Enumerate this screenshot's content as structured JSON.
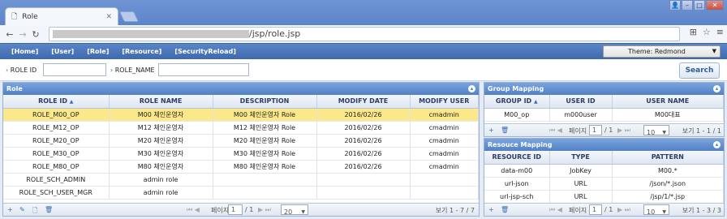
{
  "browser": {
    "tab_title": "Role",
    "url_path": "/jsp/role.jsp"
  },
  "menu": [
    "[Home]",
    "[User]",
    "[Role]",
    "[Resource]",
    "[SecurityReload]"
  ],
  "theme": "Theme: Redmond",
  "search": {
    "role_id_label": "ROLE ID",
    "role_name_label": "ROLE_NAME",
    "button": "Search"
  },
  "role": {
    "title": "Role",
    "columns": [
      "ROLE ID",
      "ROLE NAME",
      "DESCRIPTION",
      "MODIFY DATE",
      "MODIFY USER"
    ],
    "rows": [
      [
        "ROLE_M00_OP",
        "M00 체인운영자",
        "M00 체인운영자 Role",
        "2016/02/26",
        "cmadmin"
      ],
      [
        "ROLE_M12_OP",
        "M12 체인운영자",
        "M12 체인운영자 Role",
        "2016/02/26",
        "cmadmin"
      ],
      [
        "ROLE_M20_OP",
        "M20 체인운영자",
        "M20 체인운영자 Role",
        "2016/02/26",
        "cmadmin"
      ],
      [
        "ROLE_M30_OP",
        "M30 체인운영자",
        "M30 체인운영자 Role",
        "2016/02/26",
        "cmadmin"
      ],
      [
        "ROLE_M80_OP",
        "M80 체인운영자",
        "M80 체인운영자 Role",
        "2016/02/26",
        "cmadmin"
      ],
      [
        "ROLE_SCH_ADMIN",
        "admin role",
        "",
        "",
        ""
      ],
      [
        "ROLE_SCH_USER_MGR",
        "admin role",
        "",
        "",
        ""
      ]
    ],
    "pager": {
      "page_label": "페이지",
      "page": "1",
      "of": "/ 1",
      "size": "20",
      "view": "보기 1 - 7 / 7"
    }
  },
  "group": {
    "title": "Group Mapping",
    "columns": [
      "GROUP ID",
      "USER ID",
      "USER NAME"
    ],
    "rows": [
      [
        "M00_op",
        "m000user",
        "M00대표"
      ]
    ],
    "pager": {
      "page_label": "페이지",
      "page": "1",
      "of": "/ 1",
      "size": "10",
      "view": "보기 1 - 1 / 1"
    }
  },
  "resource": {
    "title": "Resouce Mapping",
    "columns": [
      "RESOURCE ID",
      "TYPE",
      "PATTERN"
    ],
    "rows": [
      [
        "data-m00",
        "JobKey",
        "M00.*"
      ],
      [
        "url-json",
        "URL",
        "/json/*.json"
      ],
      [
        "url-jsp-sch",
        "URL",
        "/jsp/1/*.jsp"
      ]
    ],
    "pager": {
      "page_label": "페이지",
      "page": "1",
      "of": "/ 1",
      "size": "10",
      "view": "보기 1 - 3 / 3"
    }
  }
}
